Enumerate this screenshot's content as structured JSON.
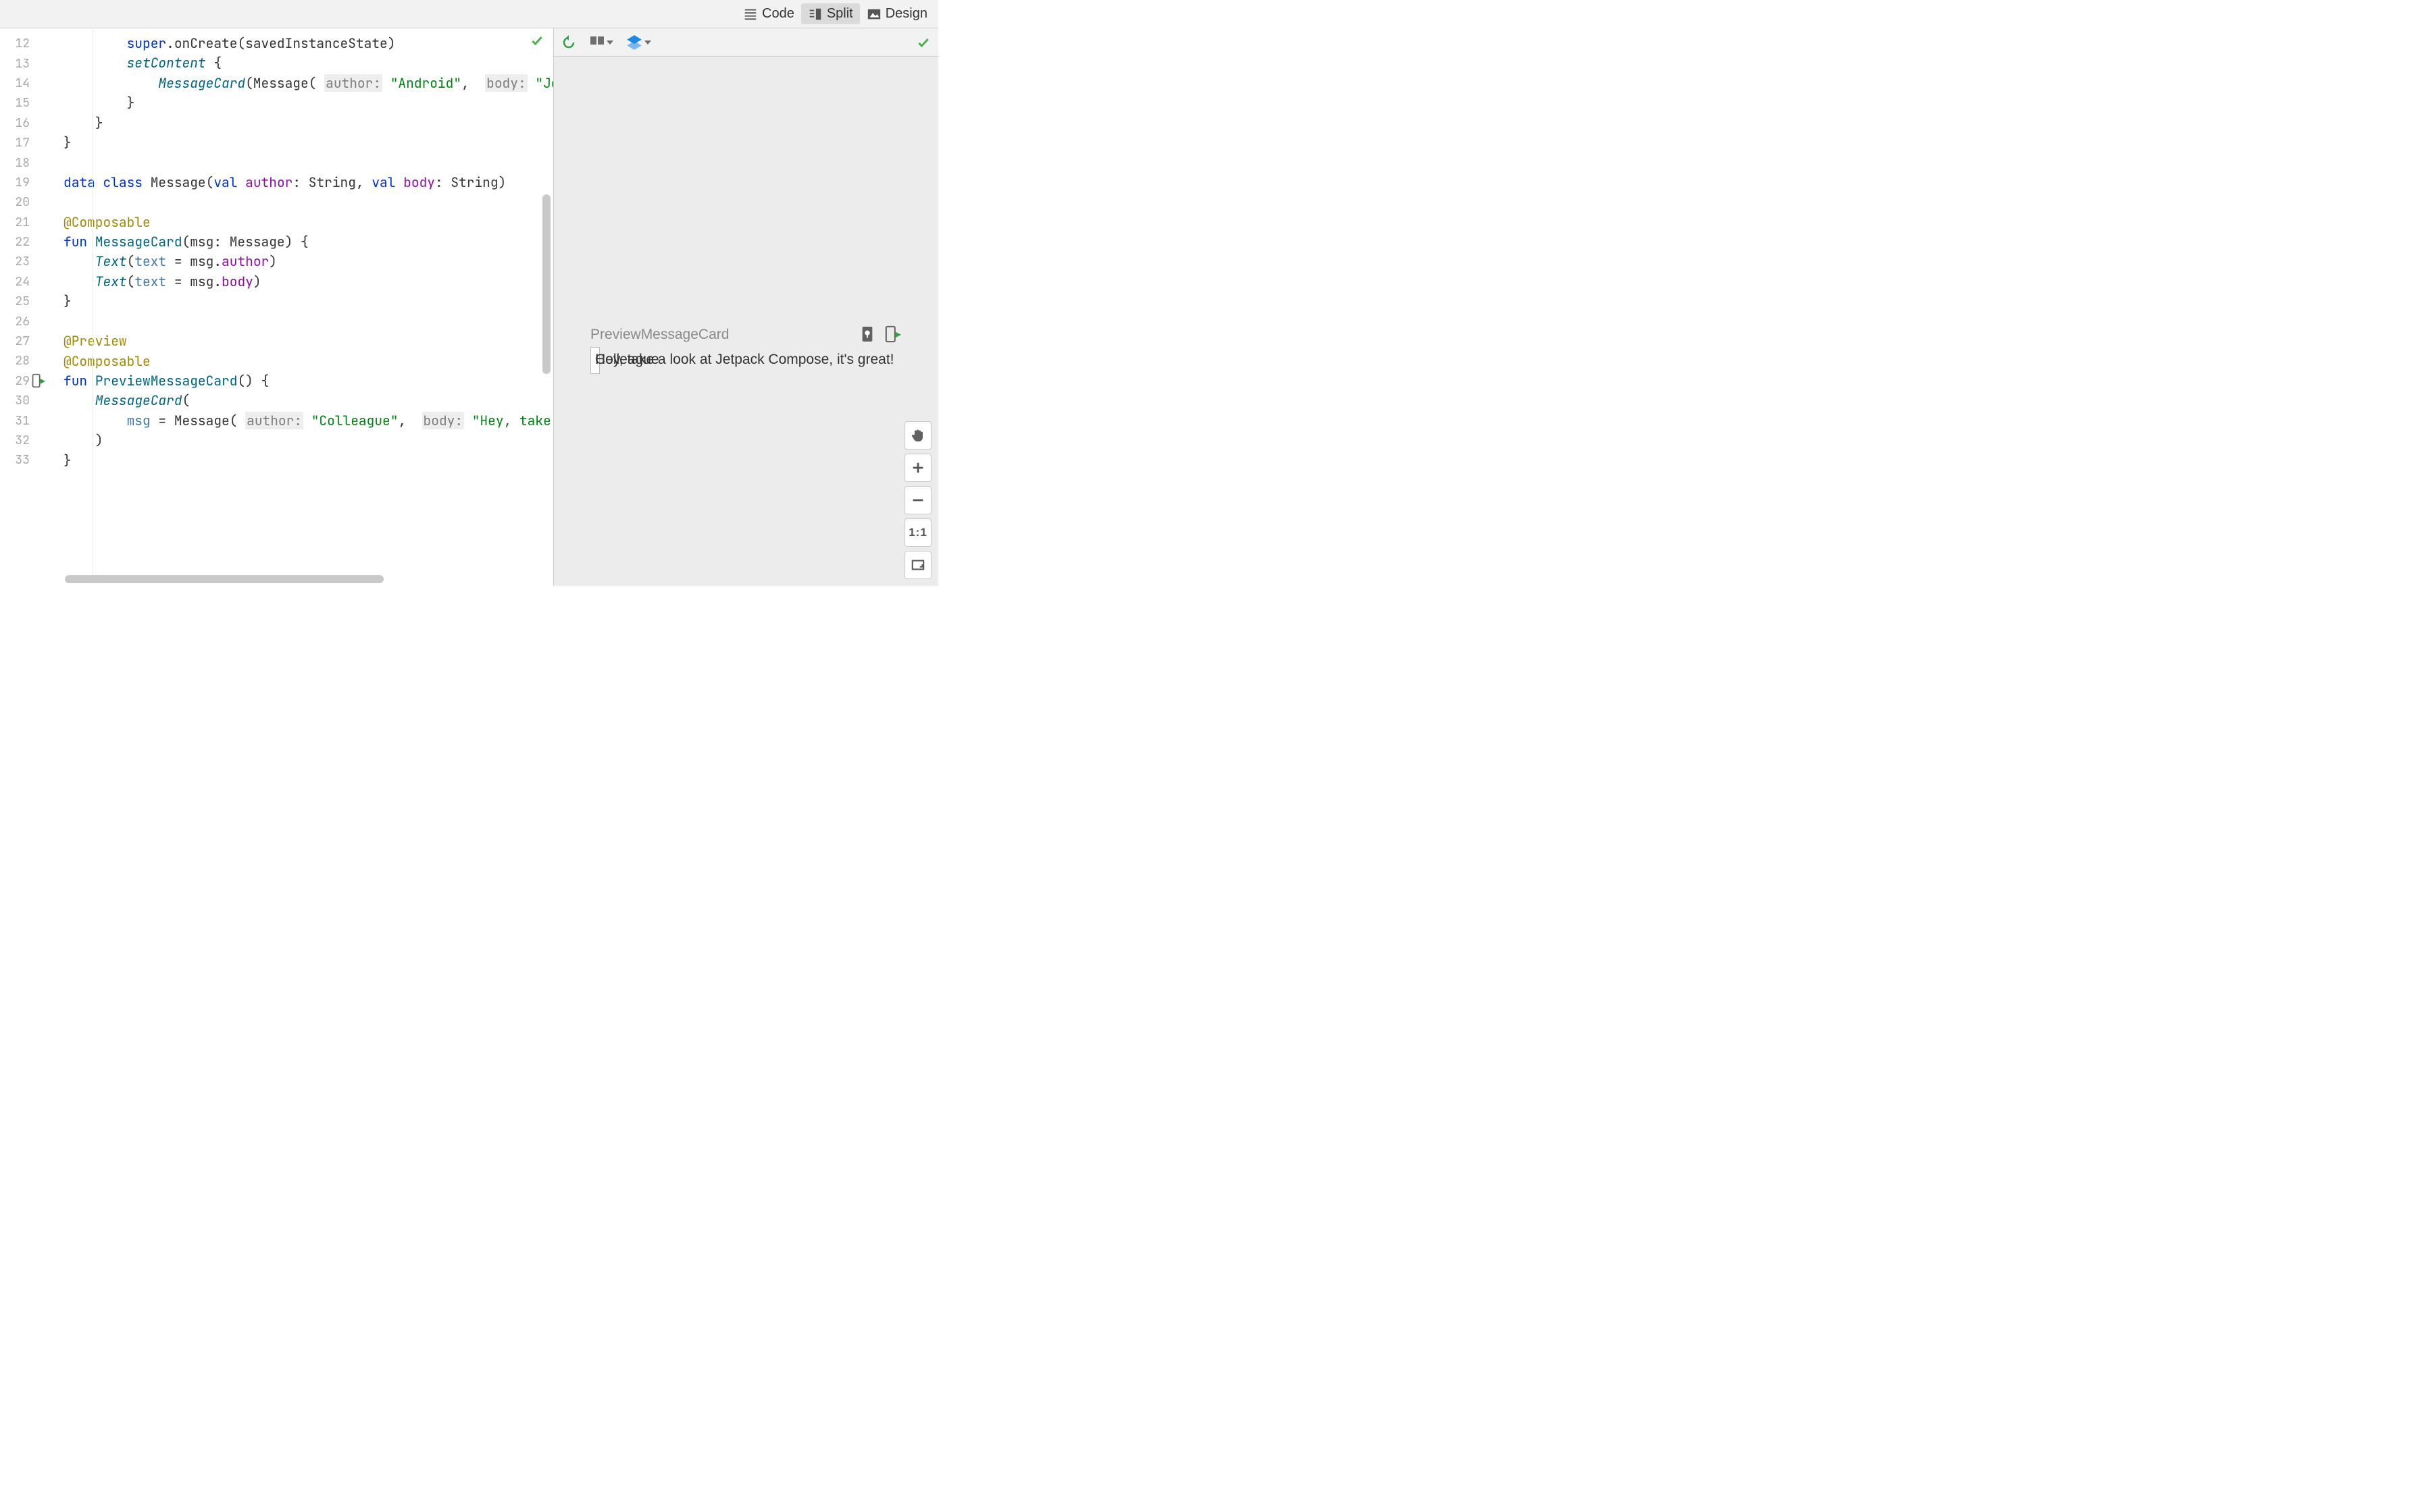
{
  "tabs": {
    "code": "Code",
    "split": "Split",
    "design": "Design",
    "active": "split"
  },
  "gutter_start": 12,
  "gutter_end": 33,
  "run_gutter_line": 29,
  "code_lines": [
    {
      "indent": 8,
      "tokens": [
        {
          "t": "super",
          "c": "kw"
        },
        {
          "t": ".onCreate(savedInstanceState)",
          "c": "plain"
        }
      ]
    },
    {
      "indent": 8,
      "tokens": [
        {
          "t": "setContent",
          "c": "fn-call-italic"
        },
        {
          "t": " {",
          "c": "plain"
        }
      ]
    },
    {
      "indent": 12,
      "tokens": [
        {
          "t": "MessageCard",
          "c": "fn-call-italic"
        },
        {
          "t": "(Message( ",
          "c": "plain"
        },
        {
          "t": "author:",
          "c": "param"
        },
        {
          "t": " ",
          "c": "plain"
        },
        {
          "t": "\"Android\"",
          "c": "str"
        },
        {
          "t": ",  ",
          "c": "plain"
        },
        {
          "t": "body:",
          "c": "param"
        },
        {
          "t": " ",
          "c": "plain"
        },
        {
          "t": "\"Jetpack Com",
          "c": "str"
        }
      ]
    },
    {
      "indent": 8,
      "tokens": [
        {
          "t": "}",
          "c": "plain"
        }
      ]
    },
    {
      "indent": 4,
      "tokens": [
        {
          "t": "}",
          "c": "plain"
        }
      ]
    },
    {
      "indent": 0,
      "tokens": [
        {
          "t": "}",
          "c": "plain"
        }
      ]
    },
    {
      "indent": 0,
      "tokens": []
    },
    {
      "indent": 0,
      "tokens": [
        {
          "t": "data class",
          "c": "kw"
        },
        {
          "t": " Message(",
          "c": "plain"
        },
        {
          "t": "val",
          "c": "kw"
        },
        {
          "t": " ",
          "c": "plain"
        },
        {
          "t": "author",
          "c": "propref"
        },
        {
          "t": ": String, ",
          "c": "plain"
        },
        {
          "t": "val",
          "c": "kw"
        },
        {
          "t": " ",
          "c": "plain"
        },
        {
          "t": "body",
          "c": "propref"
        },
        {
          "t": ": String)",
          "c": "plain"
        }
      ]
    },
    {
      "indent": 0,
      "tokens": []
    },
    {
      "indent": 0,
      "tokens": [
        {
          "t": "@Composable",
          "c": "ann"
        }
      ]
    },
    {
      "indent": 0,
      "tokens": [
        {
          "t": "fun",
          "c": "kw"
        },
        {
          "t": " ",
          "c": "plain"
        },
        {
          "t": "MessageCard",
          "c": "fn-decl"
        },
        {
          "t": "(msg: Message) {",
          "c": "plain"
        }
      ]
    },
    {
      "indent": 4,
      "tokens": [
        {
          "t": "Text",
          "c": "fn-call-italic"
        },
        {
          "t": "(",
          "c": "plain"
        },
        {
          "t": "text",
          "c": "argname"
        },
        {
          "t": " = msg.",
          "c": "plain"
        },
        {
          "t": "author",
          "c": "propref"
        },
        {
          "t": ")",
          "c": "plain"
        }
      ]
    },
    {
      "indent": 4,
      "tokens": [
        {
          "t": "Text",
          "c": "fn-call-italic"
        },
        {
          "t": "(",
          "c": "plain"
        },
        {
          "t": "text",
          "c": "argname"
        },
        {
          "t": " = msg.",
          "c": "plain"
        },
        {
          "t": "body",
          "c": "propref"
        },
        {
          "t": ")",
          "c": "plain"
        }
      ]
    },
    {
      "indent": 0,
      "tokens": [
        {
          "t": "}",
          "c": "plain"
        }
      ]
    },
    {
      "indent": 0,
      "tokens": []
    },
    {
      "indent": 0,
      "tokens": [
        {
          "t": "@Preview",
          "c": "ann"
        }
      ]
    },
    {
      "indent": 0,
      "tokens": [
        {
          "t": "@Composable",
          "c": "ann"
        }
      ]
    },
    {
      "indent": 0,
      "tokens": [
        {
          "t": "fun",
          "c": "kw"
        },
        {
          "t": " ",
          "c": "plain"
        },
        {
          "t": "PreviewMessageCard",
          "c": "fn-decl"
        },
        {
          "t": "() {",
          "c": "plain"
        }
      ]
    },
    {
      "indent": 4,
      "tokens": [
        {
          "t": "MessageCard",
          "c": "fn-call-italic"
        },
        {
          "t": "(",
          "c": "plain"
        }
      ]
    },
    {
      "indent": 8,
      "tokens": [
        {
          "t": "msg",
          "c": "argname"
        },
        {
          "t": " = Message( ",
          "c": "plain"
        },
        {
          "t": "author:",
          "c": "param"
        },
        {
          "t": " ",
          "c": "plain"
        },
        {
          "t": "\"Colleague\"",
          "c": "str"
        },
        {
          "t": ",  ",
          "c": "plain"
        },
        {
          "t": "body:",
          "c": "param"
        },
        {
          "t": " ",
          "c": "plain"
        },
        {
          "t": "\"Hey, take a look at",
          "c": "str"
        }
      ]
    },
    {
      "indent": 4,
      "tokens": [
        {
          "t": ")",
          "c": "plain"
        }
      ]
    },
    {
      "indent": 0,
      "tokens": [
        {
          "t": "}",
          "c": "plain"
        }
      ]
    }
  ],
  "preview": {
    "label": "PreviewMessageCard",
    "text1": "Colleague",
    "text2": "Hey, take a look at Jetpack Compose, it's great!"
  },
  "float_labels": {
    "one_to_one": "1:1"
  }
}
